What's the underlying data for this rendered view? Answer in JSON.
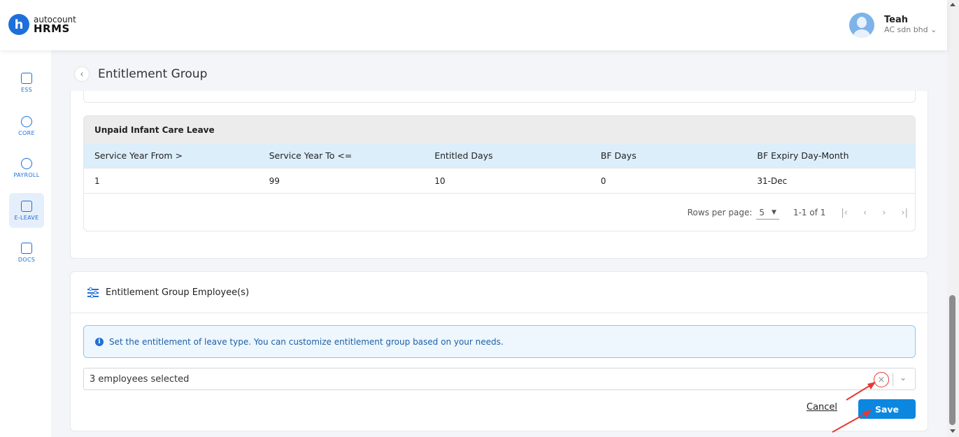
{
  "app": {
    "logo_letter": "h",
    "brand_top": "autocount",
    "brand_bottom": "HRMS"
  },
  "user": {
    "name": "Teah",
    "company": "AC sdn bhd"
  },
  "sidebar": {
    "items": [
      {
        "label": "ESS",
        "icon": "profile-card-icon",
        "active": false
      },
      {
        "label": "CORE",
        "icon": "cube-icon",
        "active": false
      },
      {
        "label": "PAYROLL",
        "icon": "dollar-icon",
        "active": false
      },
      {
        "label": "E-LEAVE",
        "icon": "calendar-icon",
        "active": true
      },
      {
        "label": "DOCS",
        "icon": "document-chart-icon",
        "active": false
      }
    ]
  },
  "page": {
    "title": "Entitlement Group",
    "back_icon": "chevron-left-icon"
  },
  "leave_table": {
    "name": "Unpaid Infant Care Leave",
    "columns": [
      "Service Year From >",
      "Service Year To <=",
      "Entitled Days",
      "BF Days",
      "BF Expiry Day-Month"
    ],
    "rows": [
      [
        "1",
        "99",
        "10",
        "0",
        "31-Dec"
      ]
    ],
    "pagination": {
      "rows_per_page_label": "Rows per page:",
      "rows_per_page": "5",
      "range": "1-1 of 1"
    }
  },
  "employees": {
    "title": "Entitlement Group Employee(s)",
    "info": "Set the entitlement of leave type. You can customize entitlement group based on your needs.",
    "selected_text": "3 employees selected",
    "cancel_label": "Cancel",
    "save_label": "Save"
  },
  "colors": {
    "accent": "#1e6fd9",
    "save": "#0b87e0",
    "annotation": "#e53935"
  }
}
